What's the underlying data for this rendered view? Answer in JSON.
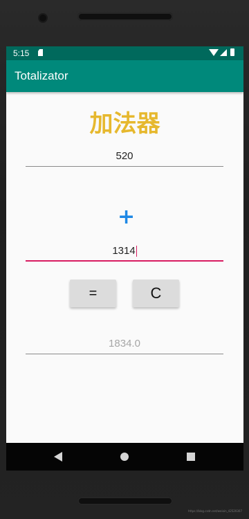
{
  "status_bar": {
    "time": "5:15",
    "icons": [
      "sd-card-icon",
      "wifi-icon",
      "signal-icon",
      "battery-icon"
    ],
    "color": "#00695c"
  },
  "app_bar": {
    "title": "Totalizator",
    "color": "#00897b"
  },
  "main": {
    "heading": "加法器",
    "heading_color": "#e6b82e",
    "first_number": "520",
    "operator": "+",
    "operator_color": "#1e88e5",
    "second_number": "1314",
    "focused_underline_color": "#d81b60",
    "equals_label": "=",
    "clear_label": "C",
    "result": "1834.0"
  },
  "nav_bar": {
    "icons": [
      "back-icon",
      "home-icon",
      "recents-icon"
    ]
  },
  "watermark": "https://blog.csdn.net/weixin_42520307"
}
